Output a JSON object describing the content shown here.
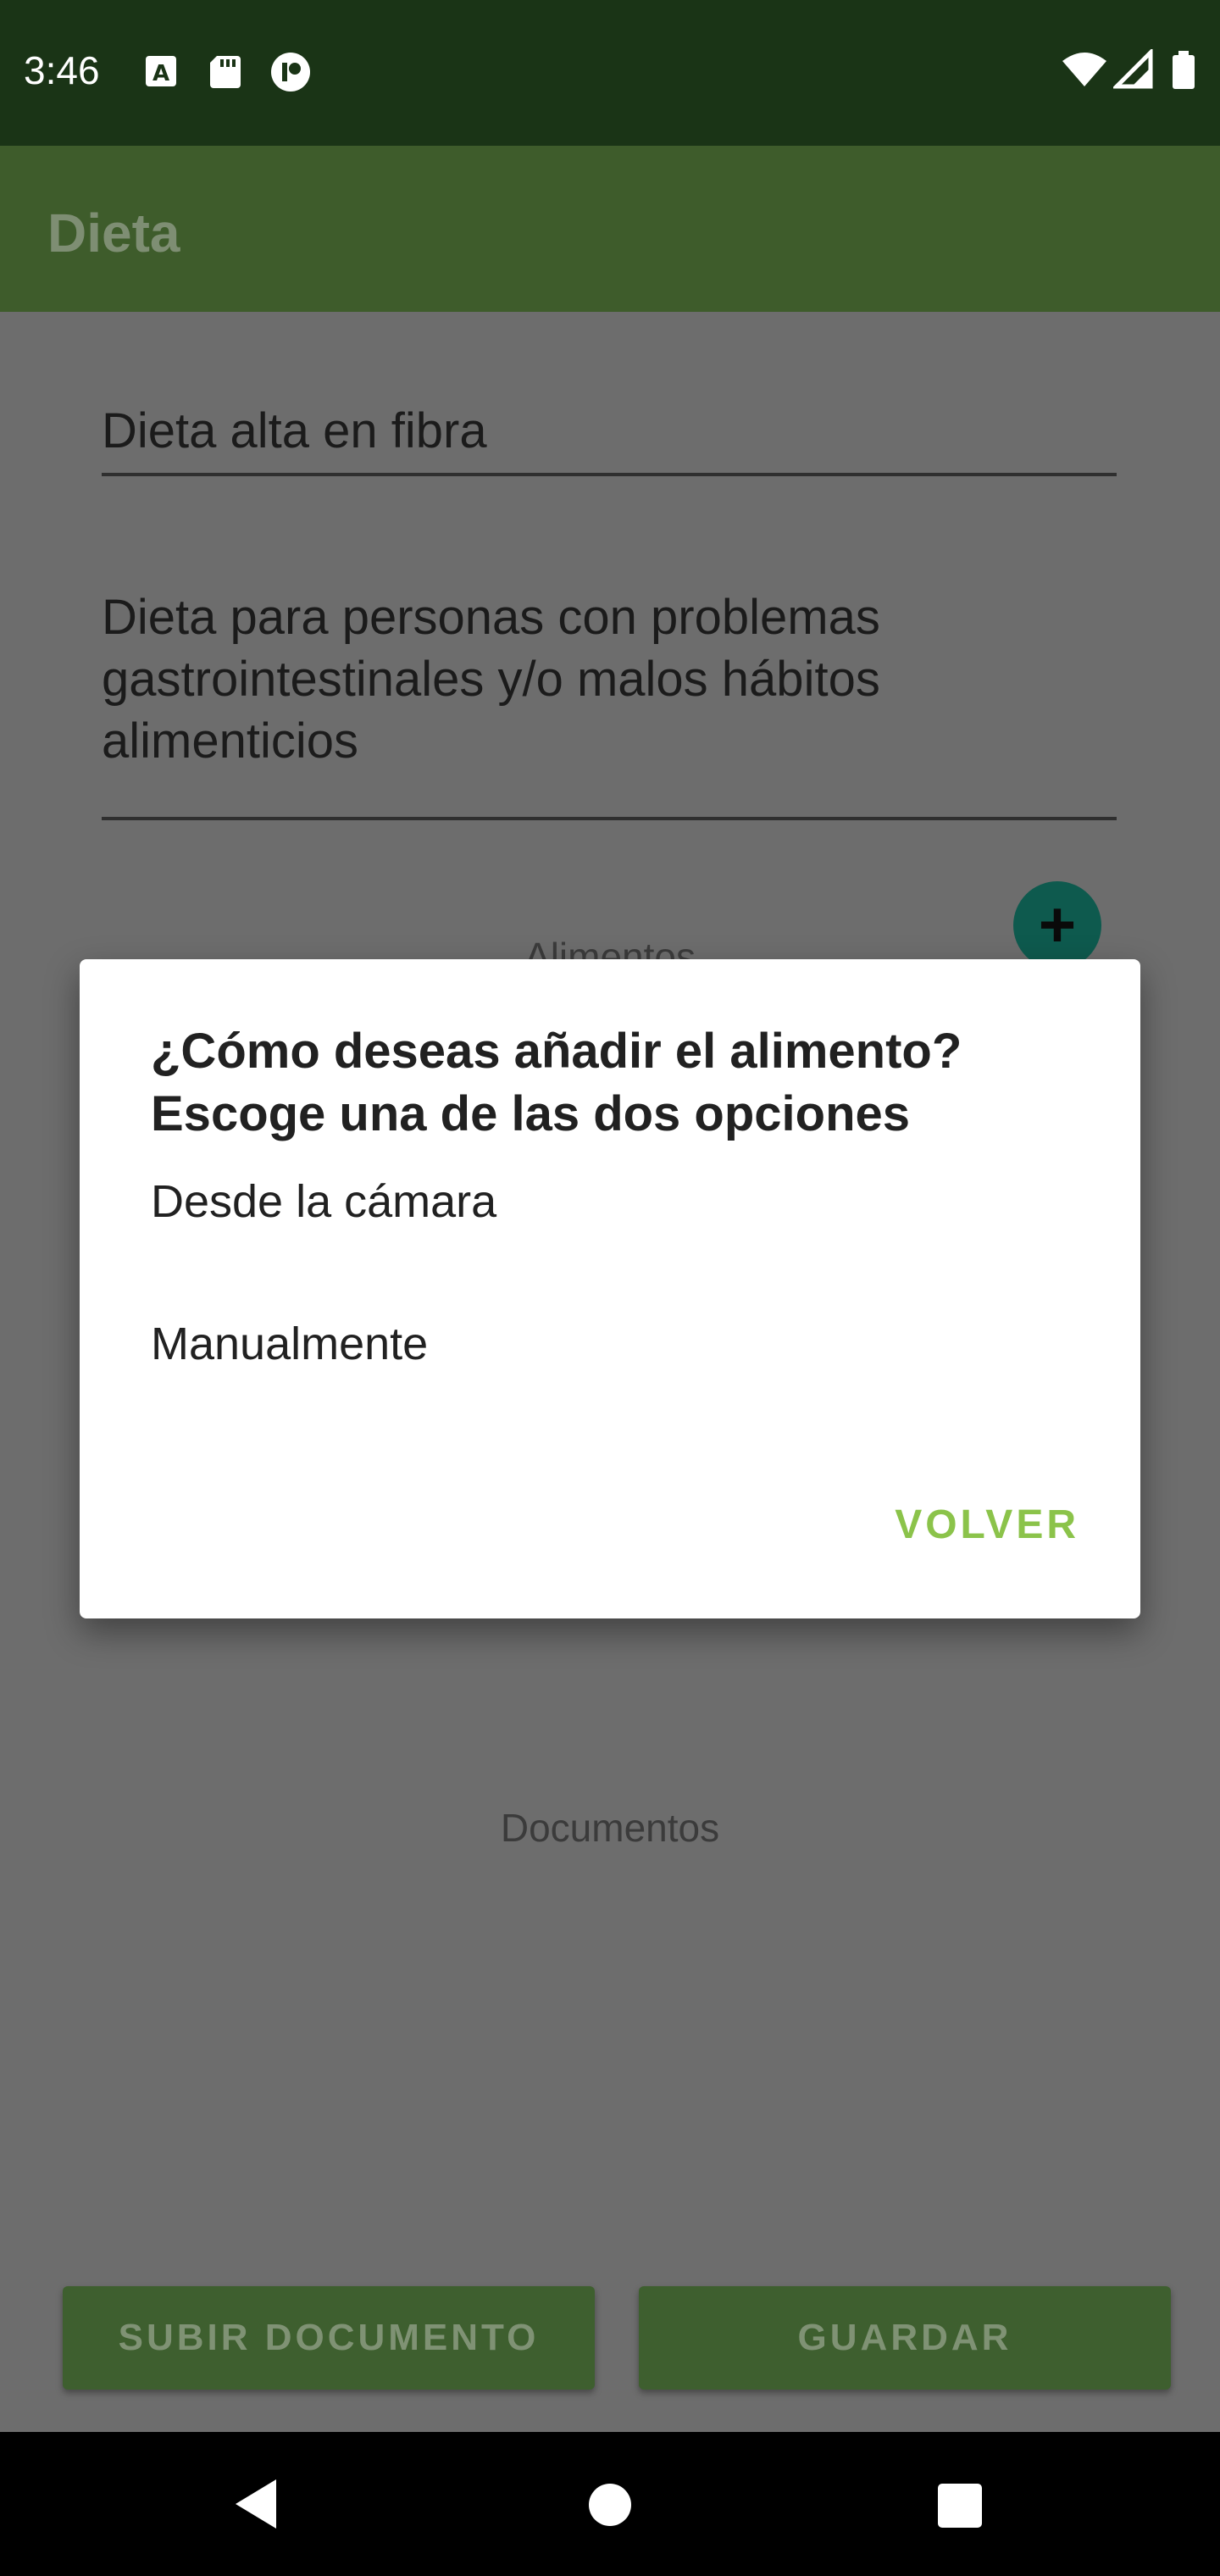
{
  "status_bar": {
    "time": "3:46",
    "left_icons": [
      "text-a-icon",
      "sd-card-icon",
      "location-pin-icon"
    ],
    "right_icons": [
      "wifi-icon",
      "cell-signal-icon",
      "battery-icon"
    ]
  },
  "app_bar": {
    "title": "Dieta"
  },
  "form": {
    "name_value": "Dieta alta en fibra",
    "description_value": "Dieta para personas con problemas gastrointestinales y/o malos hábitos alimenticios",
    "foods_label": "Alimentos",
    "documents_label": "Documentos"
  },
  "fab": {
    "icon": "plus-icon"
  },
  "dialog": {
    "title": "¿Cómo deseas añadir el alimento? Escoge una de las dos opciones",
    "options": [
      "Desde la cámara",
      "Manualmente"
    ],
    "action": "VOLVER"
  },
  "bottom_buttons": {
    "upload": "SUBIR DOCUMENTO",
    "save": "GUARDAR"
  },
  "colors": {
    "status_bar": "#1a3416",
    "app_bar": "#3e5c2b",
    "accent": "#8bc34a",
    "fab": "#0e5a4e"
  }
}
